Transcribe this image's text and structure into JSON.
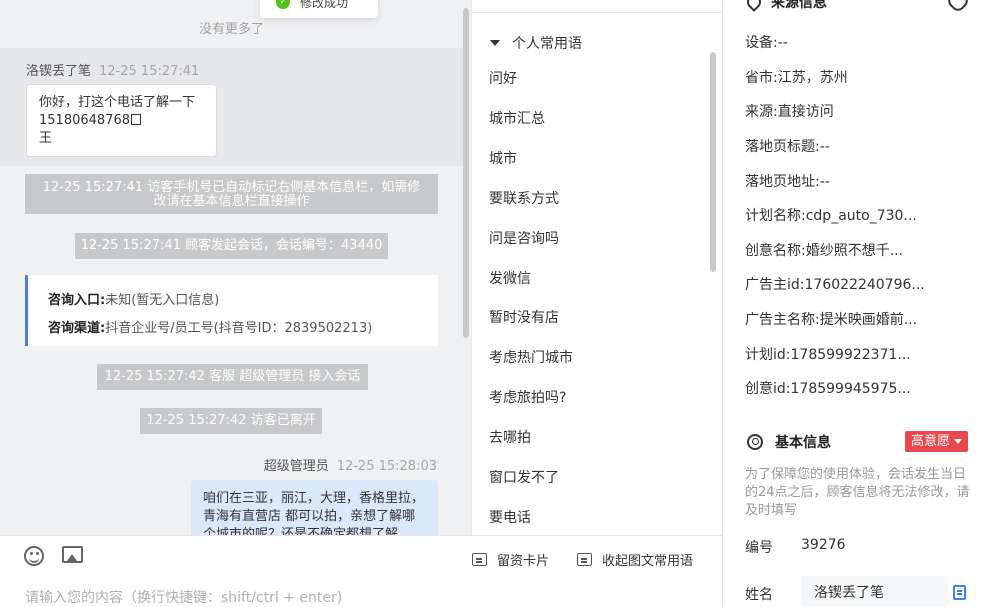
{
  "toast": {
    "text": "修改成功"
  },
  "chat": {
    "no_more": "没有更多了",
    "visitor_msg": {
      "sender": "洛锲丢了笔",
      "time": "12-25 15:27:41",
      "line1": "你好，打这个电话了解一下",
      "line2": "15180648768",
      "line3": "王"
    },
    "sys1": "12-25 15:27:41 访客手机号已自动标记右侧基本信息栏，如需修改请在基本信息栏直接操作",
    "sys2": "12-25 15:27:41 顾客发起会话，会话编号：43440",
    "card": {
      "entry_label": "咨询入口:",
      "entry_value": "未知(暂无入口信息)",
      "channel_label": "咨询渠道:",
      "channel_value": "抖音企业号/员工号(抖音号ID：2839502213)"
    },
    "sys3": "12-25 15:27:42 客服 超级管理员 接入会话",
    "sys4": "12-25 15:27:42 访客已离开",
    "agent_msg": {
      "sender": "超级管理员",
      "time": "12-25 15:28:03",
      "text": "咱们在三亚，丽江，大理，香格里拉，青海有直营店 都可以拍，亲想了解哪个城市的呢？还是不确定都想了解"
    }
  },
  "input": {
    "placeholder": "请输入您的内容（换行快捷键：shift/ctrl + enter)",
    "leave_card": "留资卡片",
    "collapse_phrases": "收起图文常用语"
  },
  "phrases": {
    "group": "个人常用语",
    "items": [
      "问好",
      "城市汇总",
      "城市",
      "要联系方式",
      "问是咨询吗",
      "发微信",
      "暂时没有店",
      "考虑热门城市",
      "考虑旅拍吗?",
      "去哪拍",
      "窗口发不了",
      "要电话"
    ]
  },
  "info": {
    "source_title": "来源信息",
    "source_rows": [
      {
        "label": "设备:",
        "value": "--"
      },
      {
        "label": "省市:",
        "value": "江苏，苏州"
      },
      {
        "label": "来源:",
        "value": "直接访问"
      },
      {
        "label": "落地页标题:",
        "value": "--"
      },
      {
        "label": "落地页地址:",
        "value": "--"
      },
      {
        "label": "计划名称:",
        "value": "cdp_auto_730..."
      },
      {
        "label": "创意名称:",
        "value": "婚纱照不想千..."
      },
      {
        "label": "广告主id:",
        "value": "176022240796..."
      },
      {
        "label": "广告主名称:",
        "value": "提米映画婚前..."
      },
      {
        "label": "计划id:",
        "value": "178599922371..."
      },
      {
        "label": "创意id:",
        "value": "178599945975..."
      }
    ],
    "basic_title": "基本信息",
    "intent_tag": "高意愿",
    "notice": "为了保障您的使用体验，会话发生当日的24点之后，顾客信息将无法修改，请及时填写",
    "number_label": "编号",
    "number_value": "39276",
    "name_label": "姓名",
    "name_value": "洛锲丢了笔"
  },
  "colors": {
    "accent": "#4a7fe0",
    "intent_red": "#e8474e",
    "agent_bubble": "#dbe7fb"
  }
}
